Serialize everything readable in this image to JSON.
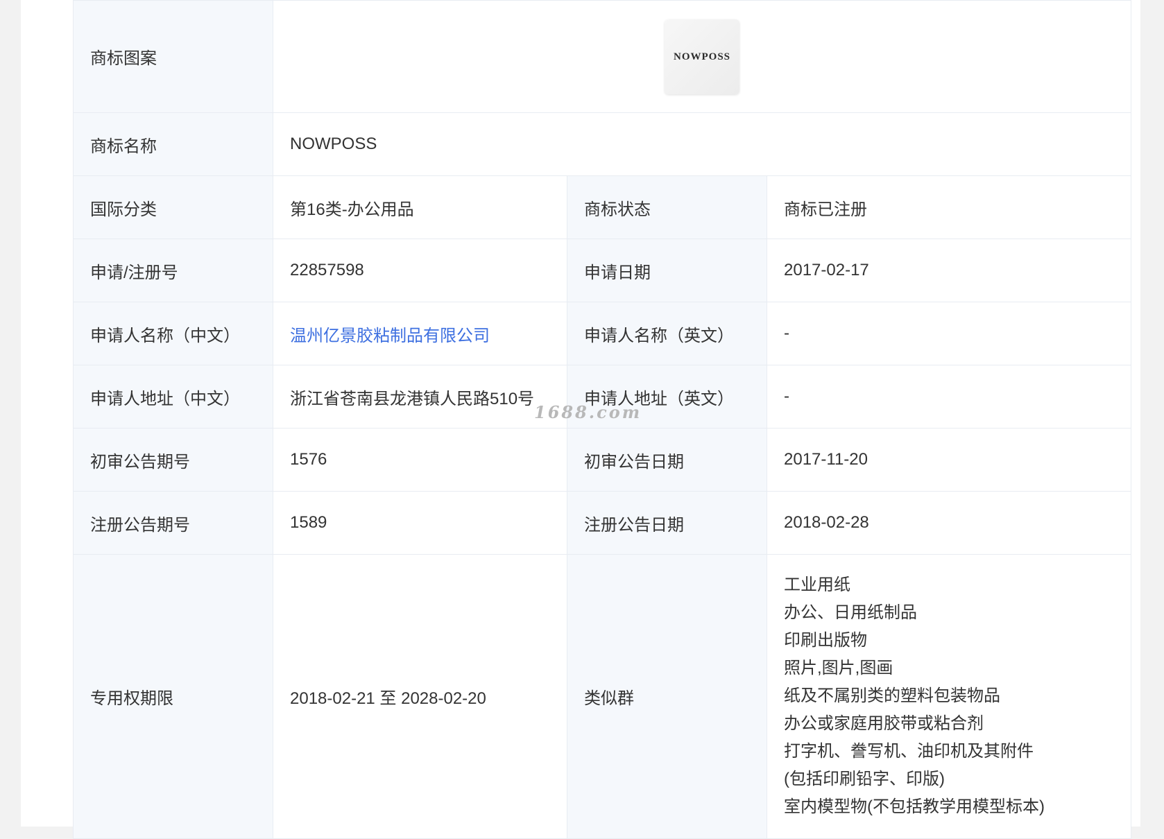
{
  "labels": {
    "image": "商标图案",
    "name": "商标名称",
    "intl_class": "国际分类",
    "status": "商标状态",
    "reg_no": "申请/注册号",
    "apply_date": "申请日期",
    "applicant_cn": "申请人名称（中文）",
    "applicant_en": "申请人名称（英文）",
    "address_cn": "申请人地址（中文）",
    "address_en": "申请人地址（英文）",
    "prelim_issue": "初审公告期号",
    "prelim_date": "初审公告日期",
    "reg_issue": "注册公告期号",
    "reg_date": "注册公告日期",
    "exclusive_period": "专用权期限",
    "similar_groups": "类似群"
  },
  "values": {
    "logo_text": "NOWPOSS",
    "name": "NOWPOSS",
    "intl_class": "第16类-办公用品",
    "status": "商标已注册",
    "reg_no": "22857598",
    "apply_date": "2017-02-17",
    "applicant_cn": "温州亿景胶粘制品有限公司",
    "applicant_en": "-",
    "address_cn": "浙江省苍南县龙港镇人民路510号",
    "address_en": "-",
    "prelim_issue": "1576",
    "prelim_date": "2017-11-20",
    "reg_issue": "1589",
    "reg_date": "2018-02-28",
    "exclusive_period": "2018-02-21 至 2028-02-20",
    "similar_groups": [
      "工业用纸",
      "办公、日用纸制品",
      "印刷出版物",
      "照片,图片,图画",
      "纸及不属别类的塑料包装物品",
      "办公或家庭用胶带或粘合剂",
      "打字机、誊写机、油印机及其附件",
      "(包括印刷铅字、印版)",
      "室内模型物(不包括教学用模型标本)"
    ]
  },
  "watermark": "1688.com",
  "colors": {
    "link": "#3d6fe0",
    "label_bg": "#f5f8fc",
    "border": "#e8ecf2"
  }
}
